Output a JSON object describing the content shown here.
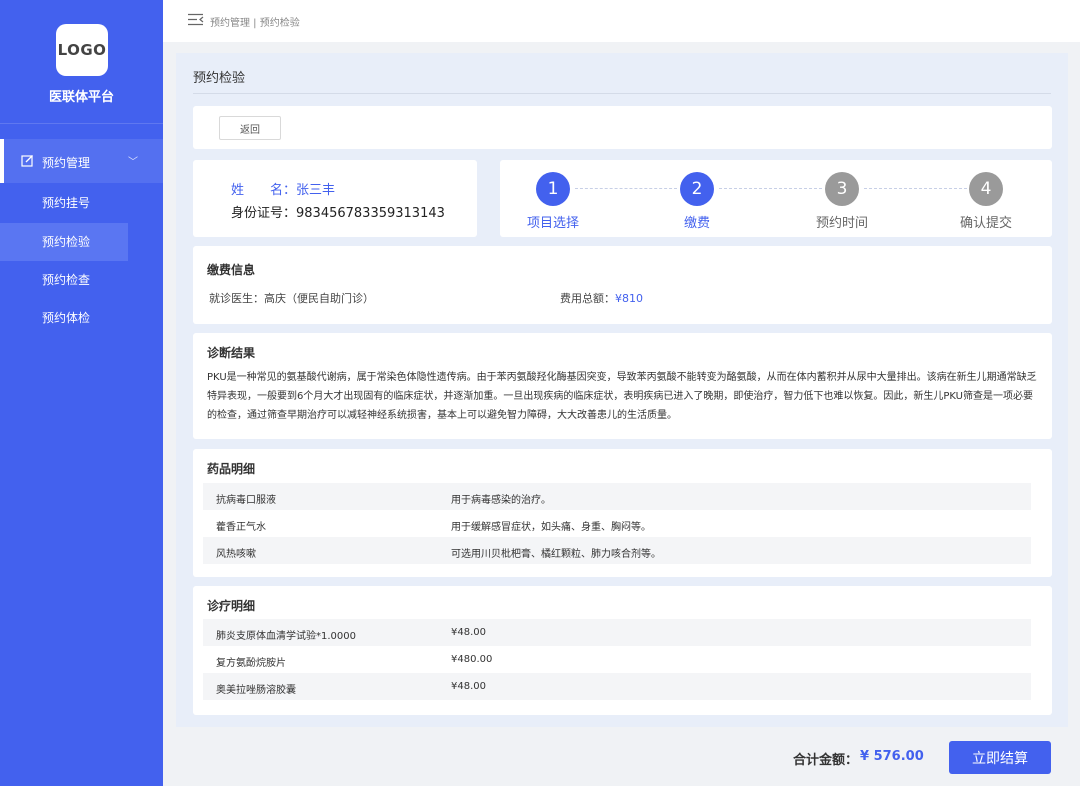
{
  "sidebar": {
    "logo_text": "LOGO",
    "platform_name": "医联体平台",
    "menu_parent": "预约管理",
    "items": [
      {
        "label": "预约挂号"
      },
      {
        "label": "预约检验"
      },
      {
        "label": "预约检查"
      },
      {
        "label": "预约体检"
      }
    ]
  },
  "header": {
    "breadcrumb": "预约管理 | 预约检验"
  },
  "page": {
    "title": "预约检验",
    "back_label": "返回"
  },
  "patient": {
    "name_label": "姓　　名：",
    "name": "张三丰",
    "id_label": "身份证号：",
    "id_number": "983456783359313143"
  },
  "steps": [
    {
      "num": "1",
      "label": "项目选择",
      "state": "done"
    },
    {
      "num": "2",
      "label": "缴费",
      "state": "active"
    },
    {
      "num": "3",
      "label": "预约时间",
      "state": "pending"
    },
    {
      "num": "4",
      "label": "确认提交",
      "state": "pending"
    }
  ],
  "fee": {
    "title": "缴费信息",
    "doctor_label": "就诊医生：",
    "doctor": "高庆（便民自助门诊）",
    "total_label": "费用总额：",
    "total": "¥810"
  },
  "diagnosis": {
    "title": "诊断结果",
    "text": "PKU是一种常见的氨基酸代谢病，属于常染色体隐性遗传病。由于苯丙氨酸羟化酶基因突变，导致苯丙氨酸不能转变为酪氨酸，从而在体内蓄积并从尿中大量排出。该病在新生儿期通常缺乏特异表现，一般要到6个月大才出现固有的临床症状，并逐渐加重。一旦出现疾病的临床症状，表明疾病已进入了晚期，即使治疗，智力低下也难以恢复。因此，新生儿PKU筛查是一项必要的检查，通过筛查早期治疗可以减轻神经系统损害，基本上可以避免智力障碍，大大改善患儿的生活质量。"
  },
  "medicines": {
    "title": "药品明细",
    "rows": [
      {
        "name": "抗病毒口服液",
        "desc": "用于病毒感染的治疗。"
      },
      {
        "name": "藿香正气水",
        "desc": "用于缓解感冒症状，如头痛、身重、胸闷等。"
      },
      {
        "name": "风热咳嗽",
        "desc": "可选用川贝枇杷膏、橘红颗粒、肺力咳合剂等。"
      }
    ]
  },
  "treatments": {
    "title": "诊疗明细",
    "rows": [
      {
        "name": "肺炎支原体血清学试验*1.0000",
        "price": "¥48.00"
      },
      {
        "name": "复方氨酚烷胺片",
        "price": "¥480.00"
      },
      {
        "name": "奥美拉唑肠溶胶囊",
        "price": "¥48.00"
      }
    ]
  },
  "footer": {
    "total_label": "合计金额：",
    "total_value": "¥ 576.00",
    "pay_label": "立即结算"
  },
  "colors": {
    "brand": "#4361ee",
    "step_inactive": "#9a9a9a"
  }
}
